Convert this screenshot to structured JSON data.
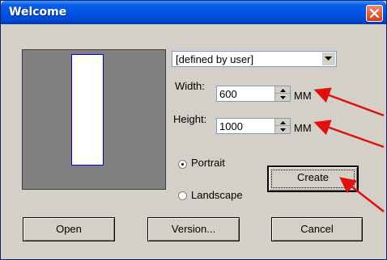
{
  "window": {
    "title": "Welcome"
  },
  "page_size": {
    "selected": "[defined by user]"
  },
  "width": {
    "label": "Width:",
    "value": "600",
    "unit": "MM"
  },
  "height": {
    "label": "Height:",
    "value": "1000",
    "unit": "MM"
  },
  "orientation": {
    "portrait_label": "Portrait",
    "landscape_label": "Landscape",
    "selected": "Portrait"
  },
  "buttons": {
    "create": "Create",
    "open": "Open",
    "version": "Version...",
    "cancel": "Cancel"
  },
  "colors": {
    "annotation_arrow": "#e01010",
    "titlebar": "#0054e3",
    "preview_background": "#808080"
  }
}
